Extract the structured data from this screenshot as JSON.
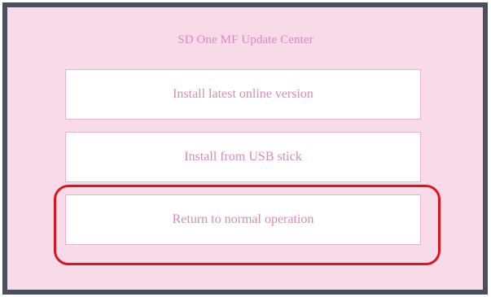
{
  "window": {
    "title": "SD One MF Update Center"
  },
  "menu": {
    "install_online_label": "Install latest online version",
    "install_usb_label": "Install from USB stick",
    "return_label": "Return to normal operation"
  },
  "colors": {
    "panel_background": "#f8dbe8",
    "panel_border": "#4a4f5e",
    "text_accent": "#d68bb6",
    "highlight_outline": "#e0121d"
  }
}
